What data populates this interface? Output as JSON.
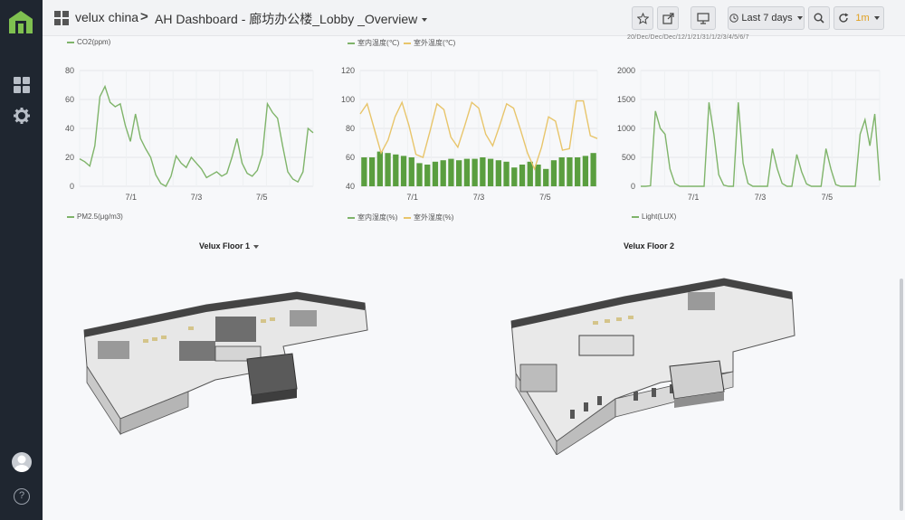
{
  "app": {
    "org": "velux china",
    "breadcrumb_sep": ">",
    "dashboard_title": "AH Dashboard - 廊坊办公楼_Lobby _Overview"
  },
  "toolbar": {
    "time_range": "Last 7 days",
    "refresh": "1m",
    "icons": [
      "star-icon",
      "share-icon",
      "tv-icon",
      "clock-icon",
      "search-icon",
      "refresh-icon"
    ]
  },
  "sidebar": {
    "icons": [
      "logo-icon",
      "dashboards-icon",
      "settings-icon",
      "avatar",
      "help-icon"
    ],
    "help_label": "?"
  },
  "panels": {
    "p1": {
      "legend_top": "CO2(ppm)",
      "legend_bottom": "PM2.5(μg/m3)"
    },
    "p2": {
      "legend_top_a": "室内温度(℃)",
      "legend_top_b": "室外温度(℃)",
      "legend_bottom_a": "室内湿度(%)",
      "legend_bottom_b": "室外湿度(%)"
    },
    "p3": {
      "legend_bottom": "Light(LUX)",
      "faded_header": "20/Dec/Dec/Dec/12/1/21/31/1/2/3/4/5/6/7"
    }
  },
  "floors": {
    "floor1": "Velux Floor 1",
    "floor2": "Velux Floor 2"
  },
  "colors": {
    "series_green": "#7fb46a",
    "bar_green": "#5a9e3f",
    "series_yellow": "#e8c56b",
    "sidebar_bg": "#1f2630",
    "logo_green": "#7fc050"
  },
  "chart_data": [
    {
      "type": "line",
      "series": [
        {
          "name": "CO2(ppm)",
          "values": [
            19,
            17,
            14,
            28,
            62,
            69,
            58,
            55,
            57,
            42,
            31,
            50,
            33,
            26,
            20,
            8,
            2,
            0,
            7,
            21,
            16,
            13,
            20,
            16,
            12,
            6,
            8,
            10,
            7,
            9,
            20,
            33,
            16,
            9,
            7,
            11,
            22,
            57,
            51,
            47,
            28,
            10,
            5,
            3,
            10,
            40,
            37
          ]
        }
      ],
      "x_ticks": [
        "7/1",
        "7/3",
        "7/5"
      ],
      "y_ticks": [
        "0",
        "20",
        "40",
        "60",
        "80"
      ],
      "ylim": [
        0,
        80
      ],
      "grid": true,
      "legend": [
        "CO2(ppm)",
        "PM2.5(μg/m3)"
      ]
    },
    {
      "type": "bar",
      "series": [
        {
          "name": "室外温度(℃)",
          "kind": "line",
          "values": [
            90,
            97,
            80,
            63,
            72,
            88,
            98,
            82,
            62,
            60,
            78,
            97,
            93,
            74,
            67,
            82,
            98,
            94,
            76,
            68,
            82,
            97,
            94,
            79,
            63,
            52,
            67,
            88,
            85,
            65,
            66,
            99,
            99,
            75,
            73
          ]
        },
        {
          "name": "室内温度(℃)",
          "kind": "bar",
          "values": [
            60,
            60,
            64,
            63,
            62,
            61,
            60,
            56,
            55,
            57,
            58,
            59,
            58,
            59,
            59,
            60,
            59,
            58,
            57,
            53,
            55,
            57,
            55,
            52,
            58,
            60,
            60,
            60,
            61,
            63
          ]
        }
      ],
      "x_ticks": [
        "7/1",
        "7/3",
        "7/5"
      ],
      "y_ticks": [
        "40",
        "60",
        "80",
        "100",
        "120"
      ],
      "ylim": [
        40,
        120
      ],
      "grid": true,
      "legend": [
        "室内温度(℃)",
        "室外温度(℃)",
        "室内湿度(%)",
        "室外湿度(%)"
      ]
    },
    {
      "type": "line",
      "series": [
        {
          "name": "Light(LUX)",
          "values": [
            0,
            0,
            10,
            1300,
            1000,
            900,
            300,
            50,
            0,
            0,
            0,
            0,
            0,
            0,
            1450,
            900,
            200,
            20,
            0,
            0,
            1450,
            400,
            50,
            0,
            0,
            0,
            0,
            650,
            300,
            50,
            0,
            0,
            550,
            250,
            40,
            0,
            0,
            0,
            650,
            300,
            30,
            0,
            0,
            0,
            0,
            900,
            1150,
            700,
            1250,
            100
          ]
        }
      ],
      "x_ticks": [
        "7/1",
        "7/3",
        "7/5"
      ],
      "y_ticks": [
        "0",
        "500",
        "1000",
        "1500",
        "2000"
      ],
      "ylim": [
        0,
        2000
      ],
      "grid": true,
      "legend": [
        "Light(LUX)"
      ]
    }
  ]
}
